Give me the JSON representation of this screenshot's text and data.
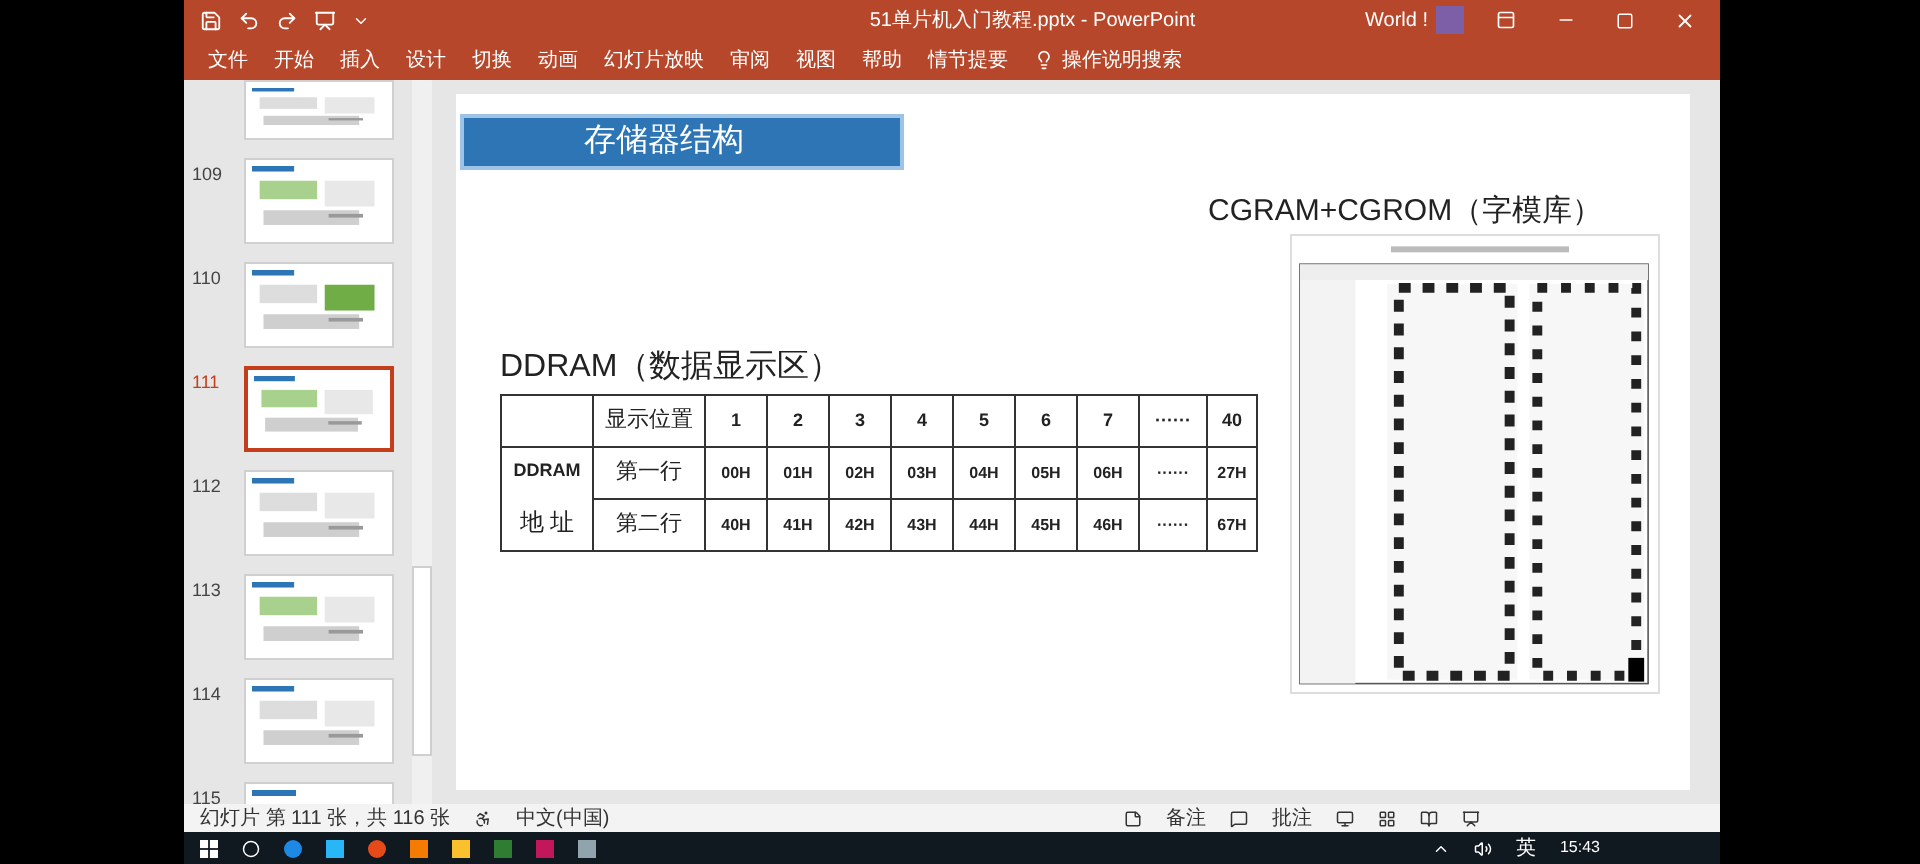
{
  "window": {
    "title": "51单片机入门教程.pptx - PowerPoint",
    "user": "World !"
  },
  "ribbon_tabs": [
    "文件",
    "开始",
    "插入",
    "设计",
    "切换",
    "动画",
    "幻灯片放映",
    "审阅",
    "视图",
    "帮助",
    "情节提要"
  ],
  "search": {
    "placeholder": "操作说明搜索"
  },
  "thumbnails": [
    {
      "selected": false
    },
    {
      "number": "109",
      "selected": false
    },
    {
      "number": "110",
      "selected": false
    },
    {
      "number": "111",
      "selected": true
    },
    {
      "number": "112",
      "selected": false
    },
    {
      "number": "113",
      "selected": false
    },
    {
      "number": "114",
      "selected": false
    },
    {
      "number": "115",
      "selected": false
    }
  ],
  "slide": {
    "title": "存储器结构",
    "cgrom_heading": "CGRAM+CGROM（字模库）",
    "ddram_heading": "DDRAM（数据显示区）",
    "table": {
      "header": [
        "显示位置",
        "1",
        "2",
        "3",
        "4",
        "5",
        "6",
        "7",
        "······",
        "40"
      ],
      "group_label": [
        "DDRAM",
        "地 址"
      ],
      "rows": [
        {
          "label": "第一行",
          "cells": [
            "00H",
            "01H",
            "02H",
            "03H",
            "04H",
            "05H",
            "06H",
            "······",
            "27H"
          ]
        },
        {
          "label": "第二行",
          "cells": [
            "40H",
            "41H",
            "42H",
            "43H",
            "44H",
            "45H",
            "46H",
            "······",
            "67H"
          ]
        }
      ]
    }
  },
  "status_bar": {
    "slide_count": "幻灯片 第 111 张，共 116 张",
    "language": "中文(中国)",
    "notes": "备注",
    "comments": "批注"
  },
  "taskbar": {
    "input_method": "英",
    "time": "15:43"
  }
}
